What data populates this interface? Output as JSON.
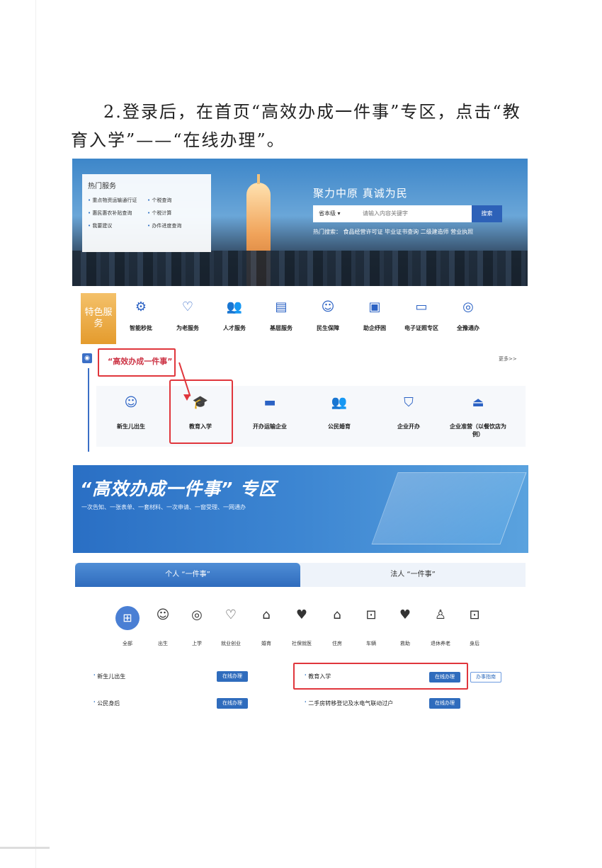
{
  "intro": "2.登录后，在首页“高效办成一件事”专区，点击“教育入学”——“在线办理”。",
  "banner": {
    "hot_title": "热门服务",
    "hot_items": [
      "重点物资运输通行证",
      "个税查询",
      "惠民惠农补贴查询",
      "个税计算",
      "我要建议",
      "办件进度查询"
    ],
    "slogan": "聚力中原  真诚为民",
    "search_scope": "省本级",
    "search_placeholder": "请输入内容关键字",
    "search_button": "搜索",
    "hot_search": "热门搜索：  食品经营许可证    毕业证书查询    二级建造师    营业执照"
  },
  "featured": {
    "badge": "特色服务",
    "items": [
      "智能秒批",
      "为老服务",
      "人才服务",
      "基层服务",
      "民生保障",
      "助企纾困",
      "电子证照专区",
      "全豫通办"
    ]
  },
  "one_thing": {
    "title": "“高效办成一件事”",
    "more": "更多>>",
    "cards": [
      "新生儿出生",
      "教育入学",
      "开办运输企业",
      "公民婚育",
      "企业开办",
      "企业准营（以餐饮店为例）"
    ]
  },
  "zone": {
    "title": "“高效办成一件事” 专区",
    "subtitle": "一次告知、一张表单、一套材料、一次申请、一窗受理、一网通办"
  },
  "tabs": [
    "个人 “一件事”",
    "法人 “一件事”"
  ],
  "categories": [
    "全部",
    "出生",
    "上学",
    "就业创业",
    "婚育",
    "社保就医",
    "住房",
    "车辆",
    "救助",
    "退休养老",
    "身后"
  ],
  "list": {
    "left": [
      "新生儿出生",
      "公民身后"
    ],
    "right": [
      "教育入学",
      "二手房转移登记及水电气联动过户"
    ],
    "online_btn": "在线办理",
    "guide_btn": "办事指南"
  }
}
